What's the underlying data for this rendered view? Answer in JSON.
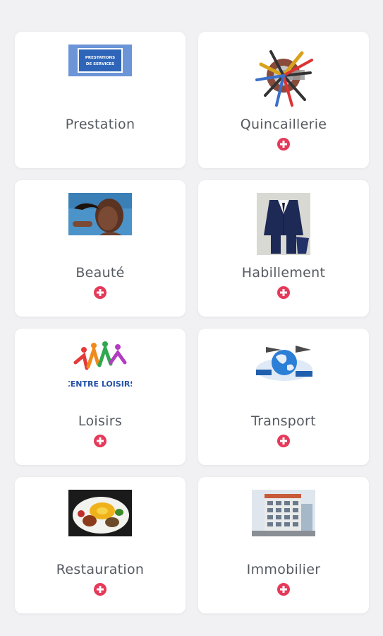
{
  "accent": "#e53a5a",
  "categories": [
    {
      "id": "prestation",
      "label": "Prestation",
      "thumb": "prestation-sign",
      "thumb_text": "PRESTATIONS DE SERVICES",
      "has_add": false
    },
    {
      "id": "quincaillerie",
      "label": "Quincaillerie",
      "thumb": "tools-illustration",
      "has_add": true
    },
    {
      "id": "beaute",
      "label": "Beauté",
      "thumb": "woman-portrait",
      "has_add": true
    },
    {
      "id": "habillement",
      "label": "Habillement",
      "thumb": "suit-mannequin",
      "has_add": true
    },
    {
      "id": "loisirs",
      "label": "Loisirs",
      "thumb": "centre-loisirs-logo",
      "thumb_text": "CENTRE LOISIRS",
      "has_add": true
    },
    {
      "id": "transport",
      "label": "Transport",
      "thumb": "transport-globe",
      "has_add": true
    },
    {
      "id": "restauration",
      "label": "Restauration",
      "thumb": "food-plate",
      "has_add": true
    },
    {
      "id": "immobilier",
      "label": "Immobilier",
      "thumb": "building-photo",
      "has_add": true
    }
  ]
}
